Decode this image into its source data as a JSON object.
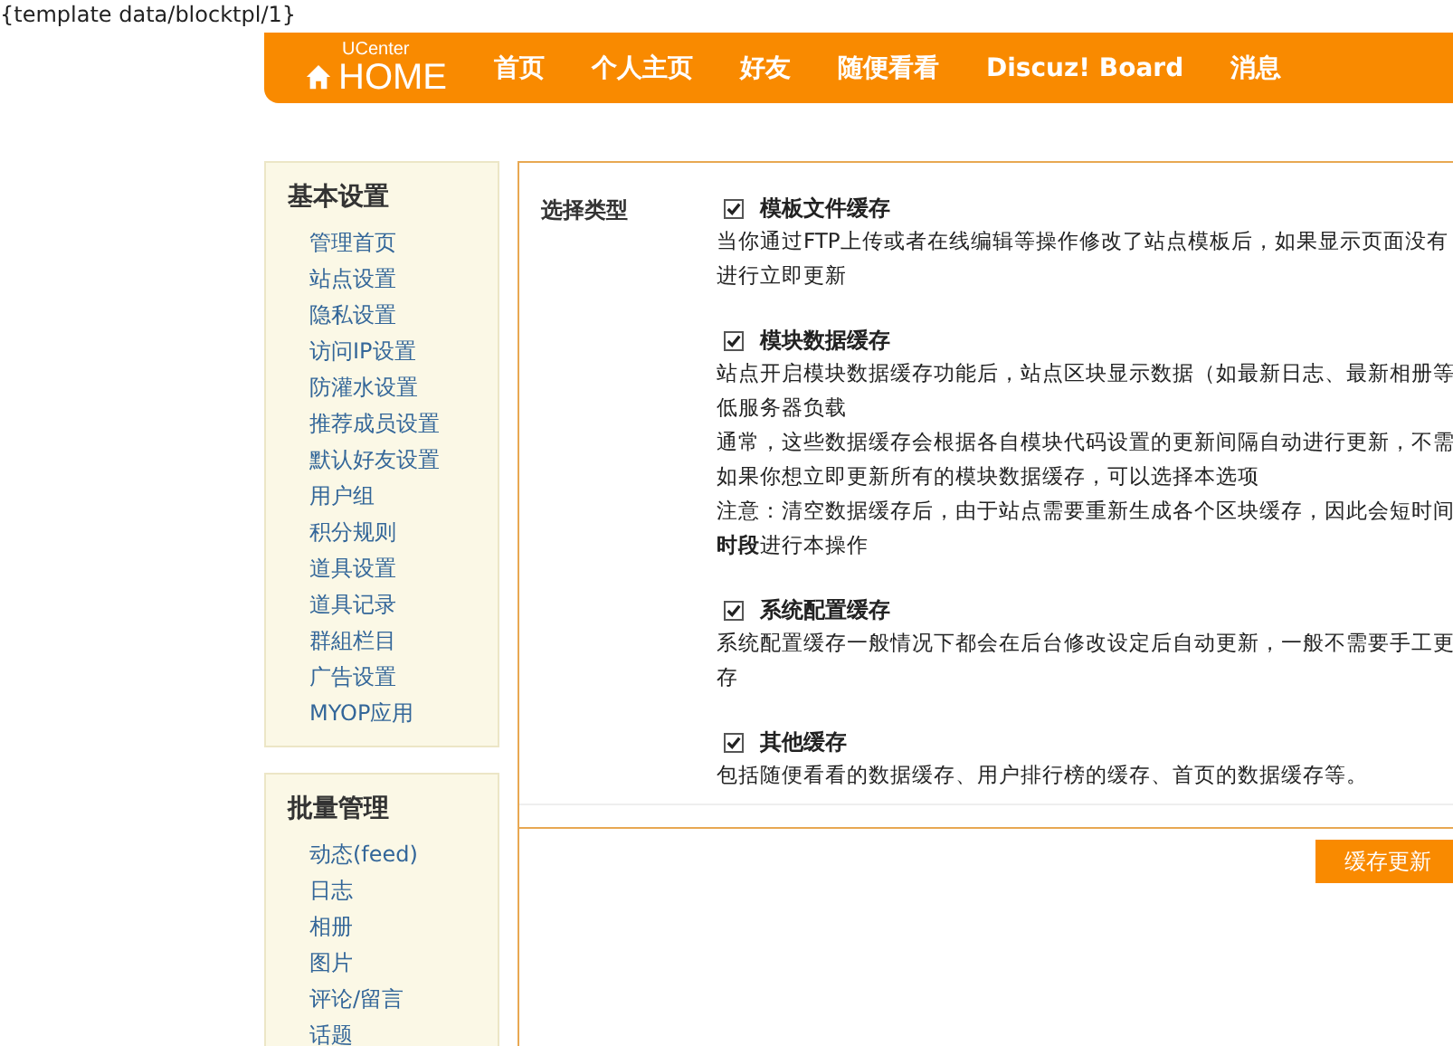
{
  "template_tag": "{template data/blocktpl/1}",
  "header": {
    "logo_small": "UCenter",
    "logo_big": "HOME",
    "nav": [
      {
        "label": "首页"
      },
      {
        "label": "个人主页"
      },
      {
        "label": "好友"
      },
      {
        "label": "随便看看"
      },
      {
        "label": "Discuz! Board"
      },
      {
        "label": "消息"
      }
    ]
  },
  "sidebar": [
    {
      "title": "基本设置",
      "items": [
        "管理首页",
        "站点设置",
        "隐私设置",
        "访问IP设置",
        "防灌水设置",
        "推荐成员设置",
        "默认好友设置",
        "用户组",
        "积分规则",
        "道具设置",
        "道具记录",
        "群組栏目",
        "广告设置",
        "MYOP应用"
      ]
    },
    {
      "title": "批量管理",
      "items": [
        "动态(feed)",
        "日志",
        "相册",
        "图片",
        "评论/留言",
        "话题"
      ]
    }
  ],
  "form": {
    "label": "选择类型",
    "options": [
      {
        "title": "模板文件缓存",
        "checked": true,
        "lines": [
          "当你通过FTP上传或者在线编辑等操作修改了站点模板后，如果显示页面没有",
          "进行立即更新"
        ]
      },
      {
        "title": "模块数据缓存",
        "checked": true,
        "lines": [
          "站点开启模块数据缓存功能后，站点区块显示数据（如最新日志、最新相册等",
          "低服务器负载",
          "通常，这些数据缓存会根据各自模块代码设置的更新间隔自动进行更新，不需",
          "如果你想立即更新所有的模块数据缓存，可以选择本选项",
          "注意：清空数据缓存后，由于站点需要重新生成各个区块缓存，因此会短时间",
          "**时段**进行本操作"
        ]
      },
      {
        "title": "系统配置缓存",
        "checked": true,
        "lines": [
          "系统配置缓存一般情况下都会在后台修改设定后自动更新，一般不需要手工更",
          "存"
        ]
      },
      {
        "title": "其他缓存",
        "checked": true,
        "lines": [
          "包括随便看看的数据缓存、用户排行榜的缓存、首页的数据缓存等。"
        ]
      }
    ],
    "submit": "缓存更新"
  }
}
